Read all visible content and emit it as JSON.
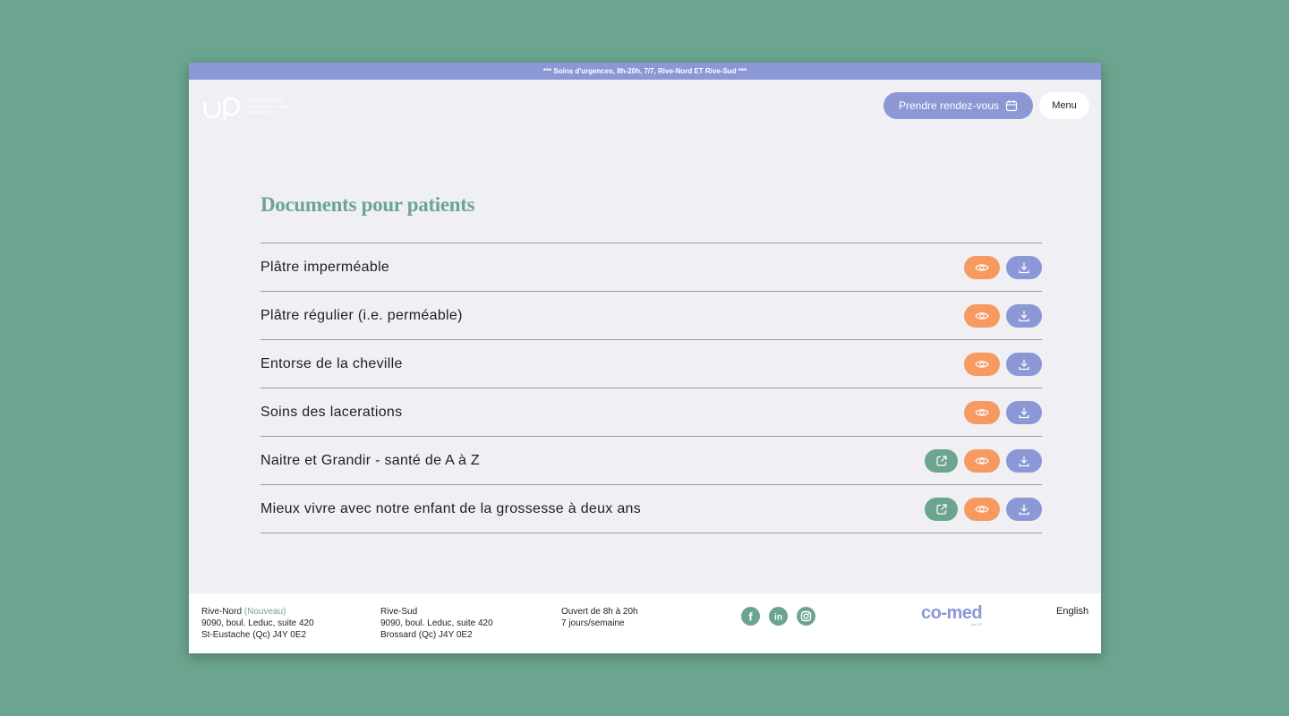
{
  "banner": {
    "text": "*** Soins d'urgences, 8h-20h, 7/7, Rive-Nord ET Rive-Sud ***"
  },
  "header": {
    "logo_tagline": "centre d'urgences pédiatriques et soins spécialisés",
    "book_label": "Prendre rendez-vous",
    "menu_label": "Menu"
  },
  "main": {
    "title": "Documents pour patients",
    "documents": [
      {
        "title": "Plâtre imperméable",
        "external": false
      },
      {
        "title": "Plâtre régulier (i.e. perméable)",
        "external": false
      },
      {
        "title": "Entorse de la cheville",
        "external": false
      },
      {
        "title": "Soins des lacerations",
        "external": false
      },
      {
        "title": "Naitre et Grandir - santé de A à Z",
        "external": true
      },
      {
        "title": "Mieux vivre avec notre enfant de la grossesse à deux ans",
        "external": true
      }
    ]
  },
  "footer": {
    "north": {
      "name": "Rive-Nord",
      "badge": "(Nouveau)",
      "line1": "9090, boul. Leduc, suite 420",
      "line2": "St-Eustache (Qc) J4Y 0E2"
    },
    "south": {
      "name": "Rive-Sud",
      "line1": "9090, boul. Leduc, suite 420",
      "line2": "Brossard (Qc) J4Y 0E2"
    },
    "hours": {
      "line1": "Ouvert de 8h à 20h",
      "line2": "7 jours/semaine"
    },
    "social_icons": [
      "facebook-icon",
      "linkedin-icon",
      "instagram-icon"
    ],
    "partner_logo": "co-med",
    "partner_sub": "par UP",
    "language_link": "English"
  },
  "colors": {
    "background": "#6ca58f",
    "accent_purple": "#8c97d6",
    "accent_orange": "#f79a62",
    "accent_green": "#6ca58f",
    "page": "#efeff4"
  }
}
